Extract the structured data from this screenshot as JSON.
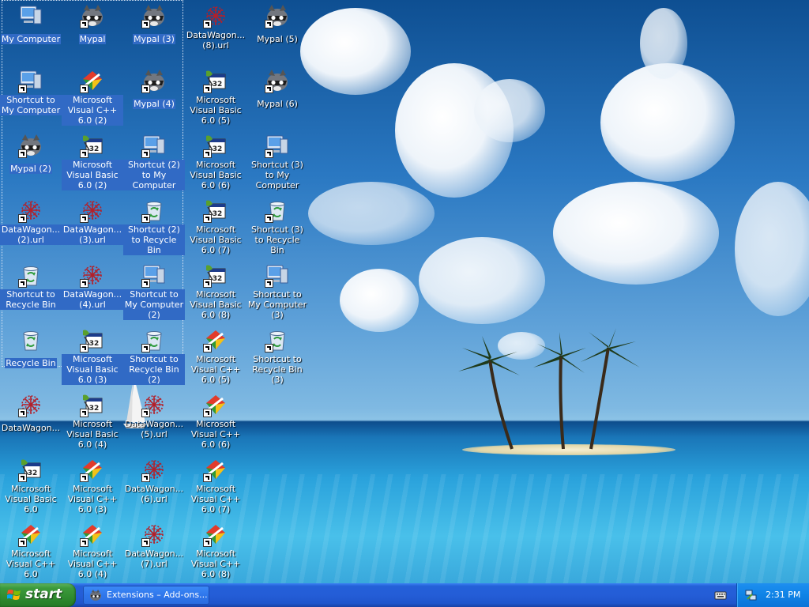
{
  "desktop": {
    "icons": [
      {
        "label": "My Computer",
        "type": "computer",
        "shortcut": false,
        "selected": true
      },
      {
        "label": "Mypal",
        "type": "mypal",
        "shortcut": true,
        "selected": true
      },
      {
        "label": "Mypal (3)",
        "type": "mypal",
        "shortcut": true,
        "selected": true
      },
      {
        "label": "DataWagon...(8).url",
        "type": "datawagon",
        "shortcut": true,
        "selected": false
      },
      {
        "label": "Mypal (5)",
        "type": "mypal",
        "shortcut": true,
        "selected": false
      },
      {
        "label": "Shortcut to My Computer",
        "type": "computer",
        "shortcut": true,
        "selected": true
      },
      {
        "label": "Microsoft Visual C++ 6.0 (2)",
        "type": "vcpp",
        "shortcut": true,
        "selected": true
      },
      {
        "label": "Mypal (4)",
        "type": "mypal",
        "shortcut": true,
        "selected": true
      },
      {
        "label": "Microsoft Visual Basic 6.0 (5)",
        "type": "vb",
        "shortcut": true,
        "selected": false
      },
      {
        "label": "Mypal (6)",
        "type": "mypal",
        "shortcut": true,
        "selected": false
      },
      {
        "label": "Mypal (2)",
        "type": "mypal",
        "shortcut": true,
        "selected": true
      },
      {
        "label": "Microsoft Visual Basic 6.0 (2)",
        "type": "vb",
        "shortcut": true,
        "selected": true
      },
      {
        "label": "Shortcut (2) to My Computer",
        "type": "computer",
        "shortcut": true,
        "selected": true
      },
      {
        "label": "Microsoft Visual Basic 6.0 (6)",
        "type": "vb",
        "shortcut": true,
        "selected": false
      },
      {
        "label": "Shortcut (3) to My Computer",
        "type": "computer",
        "shortcut": true,
        "selected": false
      },
      {
        "label": "DataWagon...(2).url",
        "type": "datawagon",
        "shortcut": true,
        "selected": true
      },
      {
        "label": "DataWagon...(3).url",
        "type": "datawagon",
        "shortcut": true,
        "selected": true
      },
      {
        "label": "Shortcut (2) to Recycle Bin",
        "type": "recycle",
        "shortcut": true,
        "selected": true
      },
      {
        "label": "Microsoft Visual Basic 6.0 (7)",
        "type": "vb",
        "shortcut": true,
        "selected": false
      },
      {
        "label": "Shortcut (3) to Recycle Bin",
        "type": "recycle",
        "shortcut": true,
        "selected": false
      },
      {
        "label": "Shortcut to Recycle Bin",
        "type": "recycle",
        "shortcut": true,
        "selected": true
      },
      {
        "label": "DataWagon...(4).url",
        "type": "datawagon",
        "shortcut": true,
        "selected": true
      },
      {
        "label": "Shortcut to My Computer (2)",
        "type": "computer",
        "shortcut": true,
        "selected": true
      },
      {
        "label": "Microsoft Visual Basic 6.0 (8)",
        "type": "vb",
        "shortcut": true,
        "selected": false
      },
      {
        "label": "Shortcut to My Computer (3)",
        "type": "computer",
        "shortcut": true,
        "selected": false
      },
      {
        "label": "Recycle Bin",
        "type": "recycle",
        "shortcut": false,
        "selected": true
      },
      {
        "label": "Microsoft Visual Basic 6.0 (3)",
        "type": "vb",
        "shortcut": true,
        "selected": true
      },
      {
        "label": "Shortcut to Recycle Bin (2)",
        "type": "recycle",
        "shortcut": true,
        "selected": true
      },
      {
        "label": "Microsoft Visual C++ 6.0 (5)",
        "type": "vcpp",
        "shortcut": true,
        "selected": false
      },
      {
        "label": "Shortcut to Recycle Bin (3)",
        "type": "recycle",
        "shortcut": true,
        "selected": false
      },
      {
        "label": "DataWagon...",
        "type": "datawagon",
        "shortcut": true,
        "selected": false
      },
      {
        "label": "Microsoft Visual Basic 6.0 (4)",
        "type": "vb",
        "shortcut": true,
        "selected": false
      },
      {
        "label": "DataWagon...(5).url",
        "type": "datawagon",
        "shortcut": true,
        "selected": false
      },
      {
        "label": "Microsoft Visual C++ 6.0 (6)",
        "type": "vcpp",
        "shortcut": true,
        "selected": false
      },
      {
        "label": "Microsoft Visual Basic 6.0",
        "type": "vb",
        "shortcut": true,
        "selected": false
      },
      {
        "label": "Microsoft Visual C++ 6.0 (3)",
        "type": "vcpp",
        "shortcut": true,
        "selected": false
      },
      {
        "label": "DataWagon...(6).url",
        "type": "datawagon",
        "shortcut": true,
        "selected": false
      },
      {
        "label": "Microsoft Visual C++ 6.0 (7)",
        "type": "vcpp",
        "shortcut": true,
        "selected": false
      },
      {
        "label": "Microsoft Visual C++ 6.0",
        "type": "vcpp",
        "shortcut": true,
        "selected": false
      },
      {
        "label": "Microsoft Visual C++ 6.0 (4)",
        "type": "vcpp",
        "shortcut": true,
        "selected": false
      },
      {
        "label": "DataWagon...(7).url",
        "type": "datawagon",
        "shortcut": true,
        "selected": false
      },
      {
        "label": "Microsoft Visual C++ 6.0 (8)",
        "type": "vcpp",
        "shortcut": true,
        "selected": false
      }
    ]
  },
  "taskbar": {
    "start_label": "start",
    "task_label": "Extensions – Add-ons...",
    "clock": "2:31 PM"
  },
  "colors": {
    "selection": "#316ac5",
    "taskbar_blue": "#245dd7",
    "start_green": "#3c9a3c",
    "tray_blue": "#0f83e6"
  }
}
